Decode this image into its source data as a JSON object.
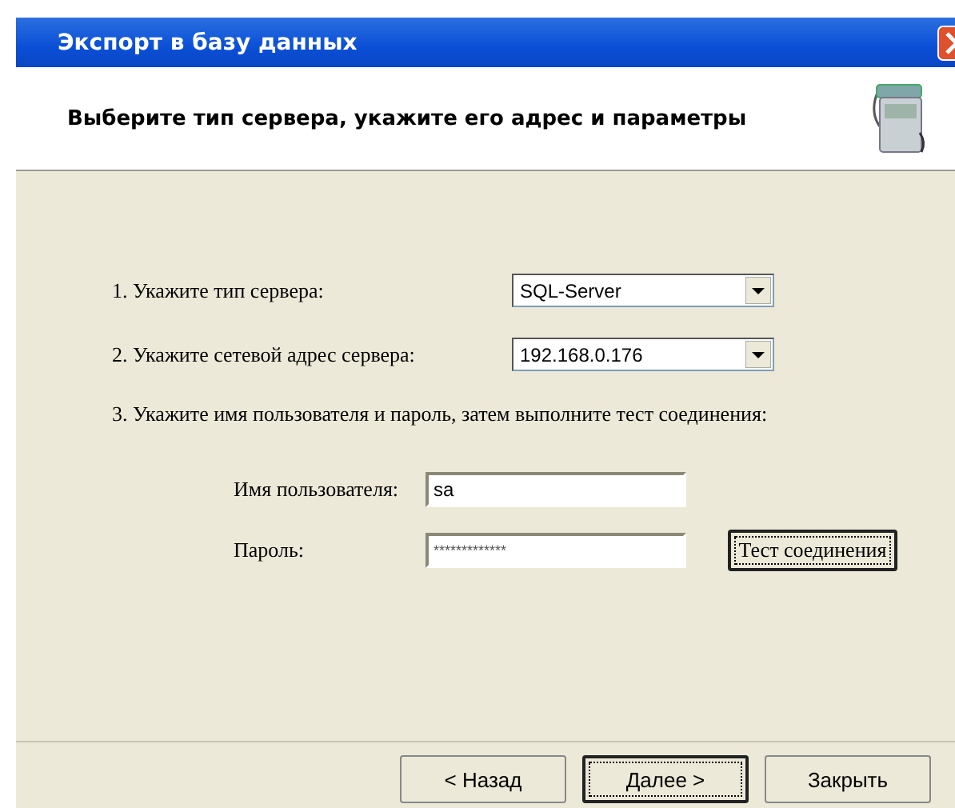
{
  "window": {
    "title": "Экспорт в базу данных"
  },
  "header": {
    "text": "Выберите тип сервера, укажите его адрес и параметры"
  },
  "steps": [
    {
      "label": "1. Укажите тип сервера:",
      "value": "SQL-Server"
    },
    {
      "label": "2. Укажите сетевой адрес сервера:",
      "value": "192.168.0.176"
    }
  ],
  "step3": "3. Укажите имя пользователя и пароль, затем выполните тест соединения:",
  "credentials": {
    "user_label": "Имя пользователя:",
    "user_value": "sa",
    "password_label": "Пароль:",
    "password_value": "*************",
    "test_button": {
      "label": "Тест соединения",
      "focused": true
    }
  },
  "buttons": [
    {
      "label": "< Назад",
      "focused": false
    },
    {
      "label": "Далее >",
      "focused": true
    },
    {
      "label": "Закрыть",
      "focused": false
    }
  ]
}
